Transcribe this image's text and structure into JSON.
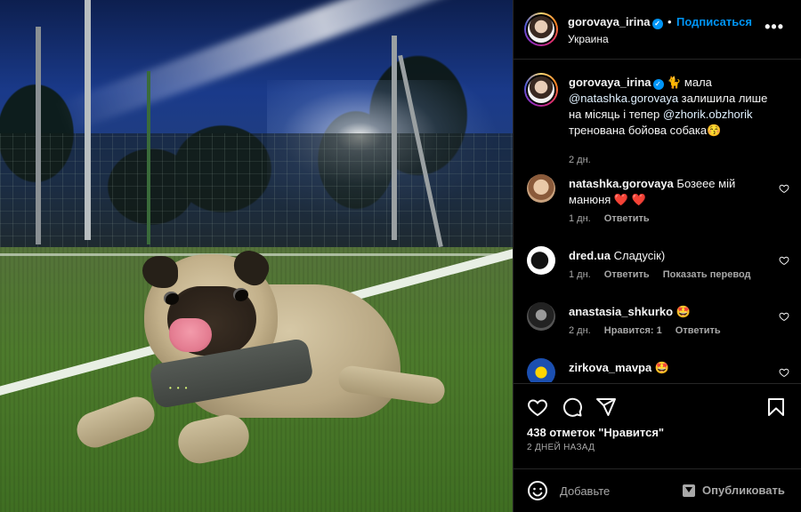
{
  "header": {
    "username": "gorovaya_irina",
    "verified_mark": "✓",
    "separator": "•",
    "follow_label": "Подписаться",
    "location": "Украина",
    "more_icon": "more-horizontal-icon",
    "more_label": "•••"
  },
  "caption": {
    "username": "gorovaya_irina",
    "text_emoji": "🐈",
    "text_part1": " мала ",
    "mention1": "@natashka.gorovaya",
    "text_part2": " залишила лише на місяць і тепер ",
    "mention2": "@zhorik.obzhorik",
    "text_part3": " тренована бойова собака😚",
    "time": "2 дн."
  },
  "comments": [
    {
      "username": "natashka.gorovaya",
      "text": "Бозеее мій манюня ❤️ ❤️",
      "time": "1 дн.",
      "actions": [
        "Ответить"
      ]
    },
    {
      "username": "dred.ua",
      "text": "Сладусік)",
      "time": "1 дн.",
      "actions": [
        "Ответить",
        "Показать перевод"
      ]
    },
    {
      "username": "anastasia_shkurko",
      "text": "🤩",
      "time": "2 дн.",
      "actions": [
        "Нравится: 1",
        "Ответить"
      ]
    },
    {
      "username": "zirkova_mavpa",
      "text": "🤩",
      "time": "",
      "actions": []
    }
  ],
  "actions": {
    "likes": "438 отметок \"Нравится\"",
    "date": "2 ДНЕЙ НАЗАД",
    "icons": [
      "heart-icon",
      "comment-icon",
      "share-icon",
      "bookmark-icon"
    ]
  },
  "composer": {
    "placeholder": "Добавьте",
    "publish_label": "Опубликовать"
  },
  "colors": {
    "accent": "#0095f6",
    "background": "#000000",
    "muted": "#a8a8a8",
    "heart_red": "#ff3040"
  }
}
